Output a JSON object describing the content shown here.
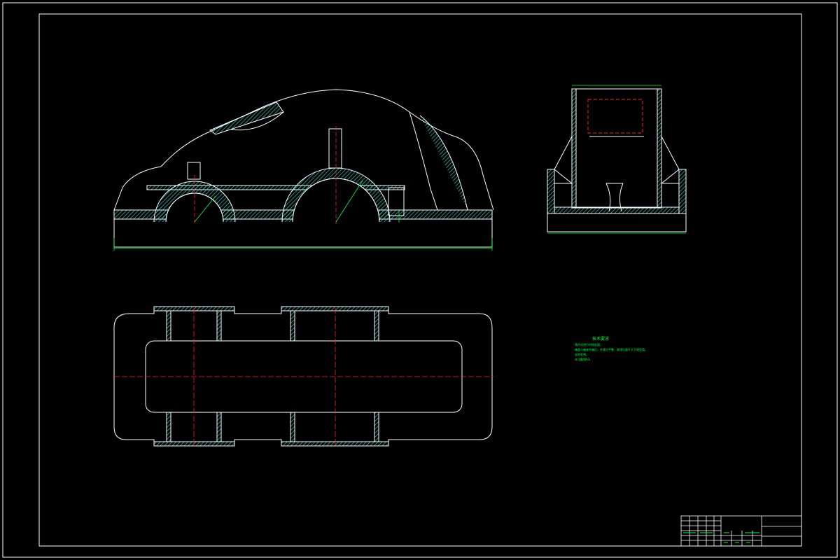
{
  "document": {
    "type": "CAD engineering drawing (reducer upper housing / box cover)",
    "background": "#000000",
    "colors": {
      "outline": "#ffffff",
      "hatch": "#33e6d9",
      "center_line": "#ff2020",
      "dimension": "#00ff40",
      "text": "#00ff40"
    },
    "views": [
      "front-view",
      "side-view",
      "top-view"
    ],
    "tech_requirements": {
      "title": "技术要求",
      "notes": [
        "铸件须进行时效处理。",
        "箱盖与箱座合箱后，外缘应平整，其错位量不大于规定值。",
        "去除毛刺。",
        "未注圆角R3。"
      ]
    },
    "dimensions": {
      "front_overall": "",
      "side_top": "",
      "side_bottom": ""
    },
    "title_block": {
      "present": true
    }
  }
}
